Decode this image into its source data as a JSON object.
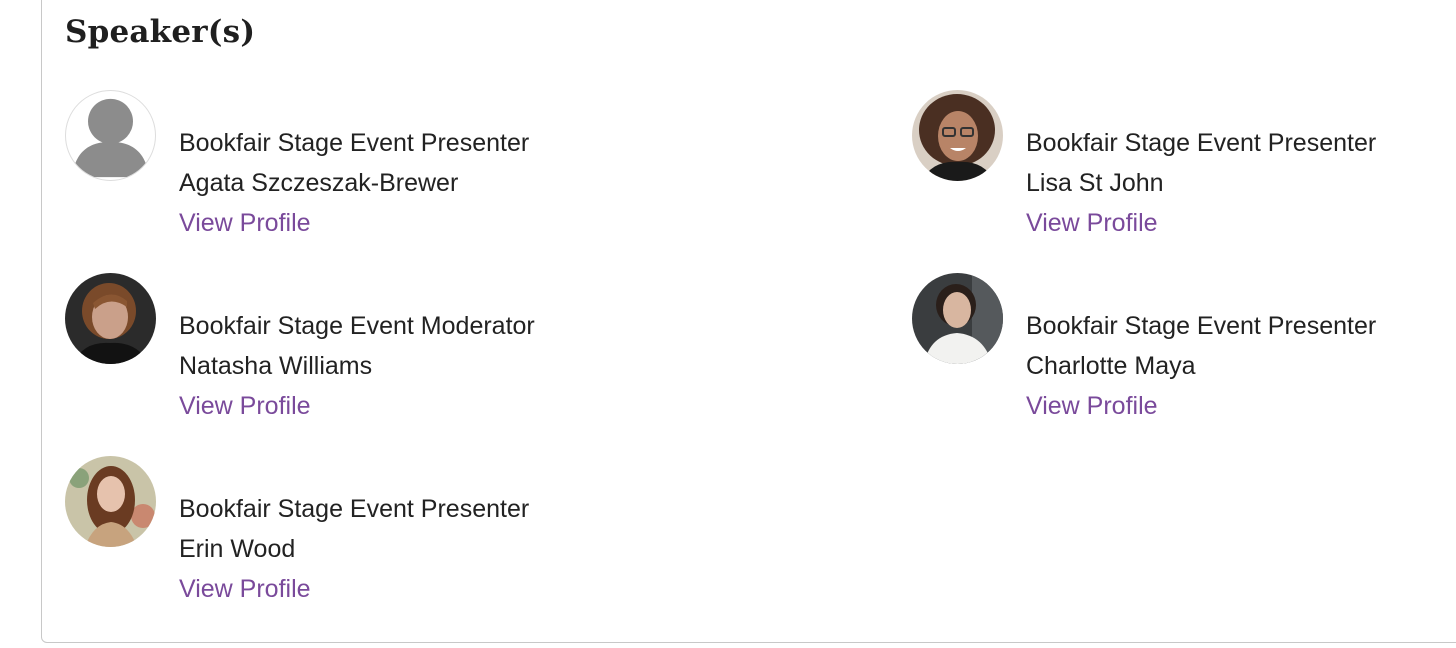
{
  "section": {
    "title": "Speaker(s)"
  },
  "speakers": [
    {
      "role": "Bookfair Stage Event Presenter",
      "name": "Agata Szczeszak-Brewer",
      "link_label": "View Profile",
      "avatar": "default-person-icon"
    },
    {
      "role": "Bookfair Stage Event Presenter",
      "name": "Lisa St John",
      "link_label": "View Profile",
      "avatar": "photo"
    },
    {
      "role": "Bookfair Stage Event Moderator",
      "name": "Natasha Williams",
      "link_label": "View Profile",
      "avatar": "photo"
    },
    {
      "role": "Bookfair Stage Event Presenter",
      "name": "Charlotte Maya",
      "link_label": "View Profile",
      "avatar": "photo"
    },
    {
      "role": "Bookfair Stage Event Presenter",
      "name": "Erin Wood",
      "link_label": "View Profile",
      "avatar": "photo"
    }
  ],
  "colors": {
    "link": "#7a4a9b",
    "text": "#222222",
    "border": "#c8c8c8"
  }
}
